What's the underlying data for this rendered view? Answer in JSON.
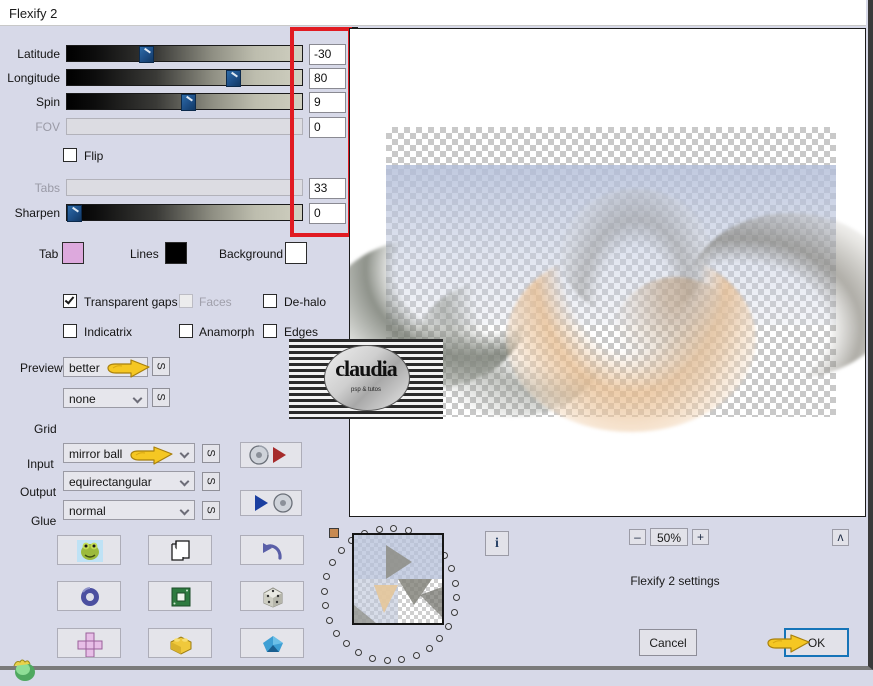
{
  "window": {
    "title": "Flexify 2"
  },
  "sliders": [
    {
      "label": "Latitude",
      "value": "-30",
      "pos": 33,
      "disabled": false
    },
    {
      "label": "Longitude",
      "value": "80",
      "pos": 72,
      "disabled": false
    },
    {
      "label": "Spin",
      "value": "9",
      "pos": 54,
      "disabled": false
    },
    {
      "label": "FOV",
      "value": "0",
      "pos": 0,
      "disabled": true
    },
    {
      "label": "Tabs",
      "value": "33",
      "pos": 0,
      "disabled": true
    },
    {
      "label": "Sharpen",
      "value": "0",
      "pos": 0,
      "disabled": false
    }
  ],
  "flip": {
    "label": "Flip",
    "checked": false
  },
  "colors": {
    "tab_label": "Tab",
    "tab_color": "#dda9dd",
    "lines_label": "Lines",
    "lines_color": "#000000",
    "background_label": "Background",
    "background_color": "#ffffff"
  },
  "checkboxes": [
    {
      "label": "Transparent gaps",
      "checked": true,
      "disabled": false
    },
    {
      "label": "Faces",
      "checked": false,
      "disabled": true
    },
    {
      "label": "De-halo",
      "checked": false,
      "disabled": false
    },
    {
      "label": "Indicatrix",
      "checked": false,
      "disabled": false
    },
    {
      "label": "Anamorph",
      "checked": false,
      "disabled": false
    },
    {
      "label": "Edges",
      "checked": false,
      "disabled": false
    }
  ],
  "selects": [
    {
      "label": "Preview",
      "value": "better",
      "side_button": "S"
    },
    {
      "label": "Grid",
      "value": "none",
      "side_button": "S"
    },
    {
      "label": "Input",
      "value": "mirror ball",
      "side_button": "S"
    },
    {
      "label": "Output",
      "value": "equirectangular",
      "side_button": "S"
    },
    {
      "label": "Glue",
      "value": "normal",
      "side_button": "S"
    }
  ],
  "arrow_buttons": [
    {
      "name": "load-settings-button",
      "icon": "disc-play-icon"
    },
    {
      "name": "save-settings-button",
      "icon": "play-disc-icon"
    }
  ],
  "icon_buttons": [
    {
      "name": "frog-button",
      "icon": "frog-icon"
    },
    {
      "name": "pages-button",
      "icon": "pages-icon"
    },
    {
      "name": "undo-button",
      "icon": "undo-arrow-icon"
    },
    {
      "name": "torus-button",
      "icon": "torus-icon"
    },
    {
      "name": "chip-button",
      "icon": "green-chip-icon"
    },
    {
      "name": "dice-button",
      "icon": "dice-icon"
    },
    {
      "name": "cross-button",
      "icon": "cross-net-icon"
    },
    {
      "name": "brick-button",
      "icon": "yellow-brick-icon"
    },
    {
      "name": "gem-button",
      "icon": "blue-gem-icon"
    }
  ],
  "bottom_bar": {
    "info_label": "i",
    "zoom_out": "–",
    "zoom_value": "50%",
    "zoom_in": "+",
    "collapse": "ʌ",
    "settings_text": "Flexify 2 settings",
    "cancel_label": "Cancel",
    "ok_label": "OK"
  },
  "watermark": {
    "name": "claudia",
    "subtitle": "psp & tutos"
  },
  "annotation": {
    "highlight_color": "#e11b22"
  }
}
